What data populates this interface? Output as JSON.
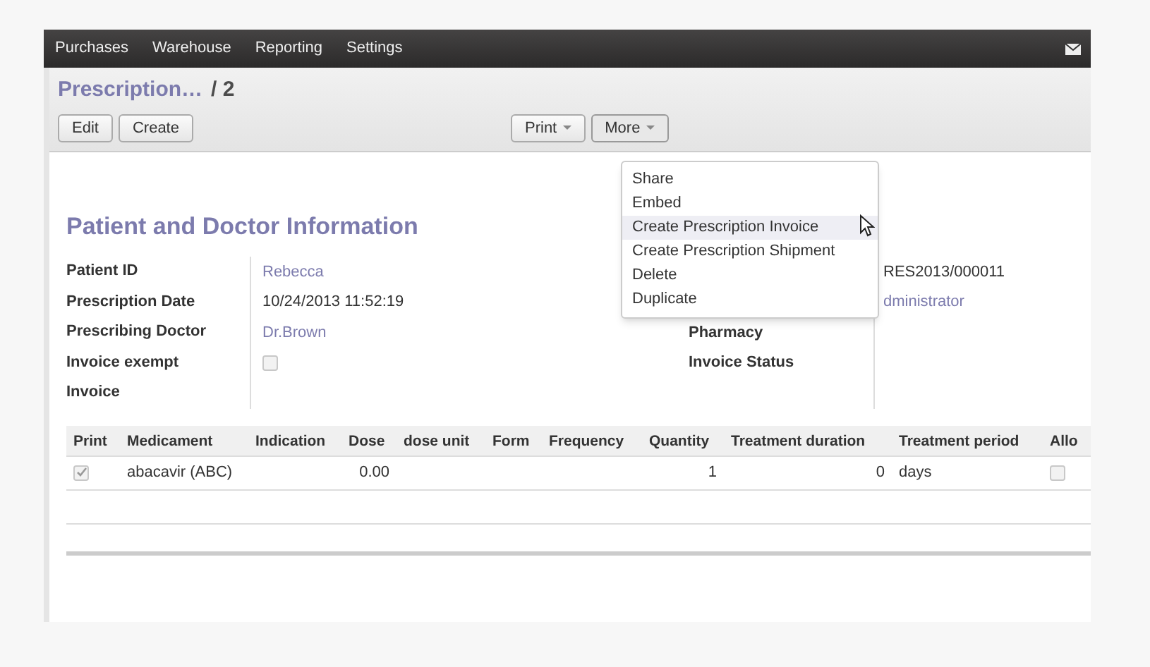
{
  "top_menu": [
    {
      "label": "Purchases"
    },
    {
      "label": "Warehouse"
    },
    {
      "label": "Reporting"
    },
    {
      "label": "Settings"
    }
  ],
  "breadcrumb": {
    "parent": "Prescription…",
    "current": "/ 2"
  },
  "buttons": {
    "left": [
      "Edit",
      "Create"
    ],
    "dropdowns": [
      {
        "label": "Print",
        "open": false
      },
      {
        "label": "More",
        "open": true
      }
    ]
  },
  "more_menu": [
    {
      "label": "Share",
      "selected": false
    },
    {
      "label": "Embed",
      "selected": false
    },
    {
      "label": "Create Prescription Invoice",
      "selected": true
    },
    {
      "label": "Create Prescription Shipment",
      "selected": false
    },
    {
      "label": "Delete",
      "selected": false
    },
    {
      "label": "Duplicate",
      "selected": false
    }
  ],
  "section_title": "Patient and Doctor Information",
  "left_fields": [
    {
      "label": "Patient ID",
      "value": "Rebecca",
      "kind": "link"
    },
    {
      "label": "Prescription Date",
      "value": "10/24/2013 11:52:19",
      "kind": "text"
    },
    {
      "label": "Prescribing Doctor",
      "value": "Dr.Brown",
      "kind": "link"
    },
    {
      "label": "Invoice exempt",
      "checked": false,
      "kind": "checkbox"
    },
    {
      "label": "Invoice",
      "kind": "empty"
    }
  ],
  "right_fields": [
    {
      "value": "RES2013/000011",
      "kind": "text"
    },
    {
      "value": "dministrator",
      "kind": "link"
    },
    {
      "label": "Pharmacy",
      "kind": "empty"
    },
    {
      "label": "Invoice Status",
      "kind": "empty"
    }
  ],
  "table": {
    "columns": [
      "Print",
      "Medicament",
      "Indication",
      "Dose",
      "dose unit",
      "Form",
      "Frequency",
      "Quantity",
      "Treatment duration",
      "Treatment period",
      "Allo"
    ],
    "rows": [
      {
        "print": true,
        "medicament": "abacavir (ABC)",
        "dose": "0.00",
        "quantity": "1",
        "treatment_duration": "0",
        "treatment_period": "days",
        "allow": false
      }
    ]
  }
}
